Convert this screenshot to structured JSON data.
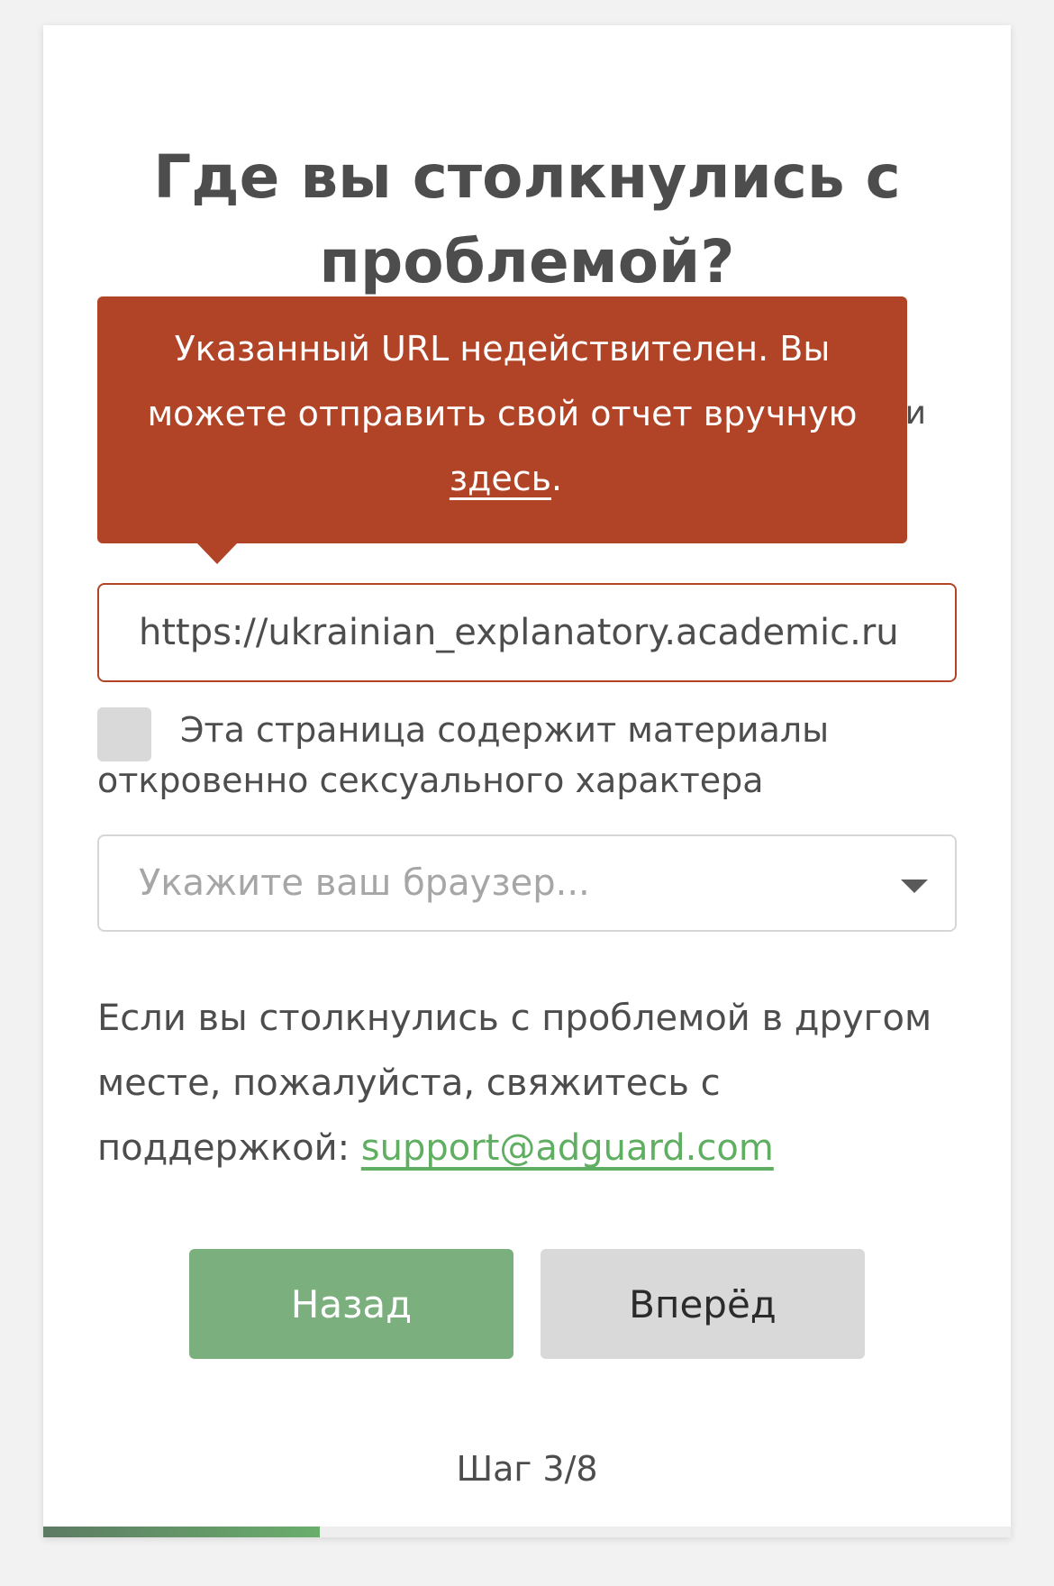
{
  "title": "Где вы столкнулись с проблемой?",
  "covered_text_fragment": "и",
  "tooltip": {
    "text": "Указанный URL недействителен. Вы можете отправить свой отчет вручную",
    "link": "здесь",
    "suffix": "."
  },
  "url_input": {
    "value": "https://ukrainian_explanatory.academic.ru"
  },
  "adult_checkbox": {
    "label": "Эта страница содержит материалы откровенно сексуального характера",
    "checked": false
  },
  "browser_select": {
    "placeholder": "Укажите ваш браузер..."
  },
  "info": {
    "text": "Если вы столкнулись с проблемой в другом месте, пожалуйста, свяжитесь с поддержкой:",
    "email": "support@adguard.com"
  },
  "buttons": {
    "back": "Назад",
    "next": "Вперёд"
  },
  "step": {
    "label": "Шаг 3/8",
    "progress": 0.2857
  },
  "colors": {
    "error": "#b14426",
    "accent_green": "#7bb07e",
    "link_green": "#5fae62"
  }
}
